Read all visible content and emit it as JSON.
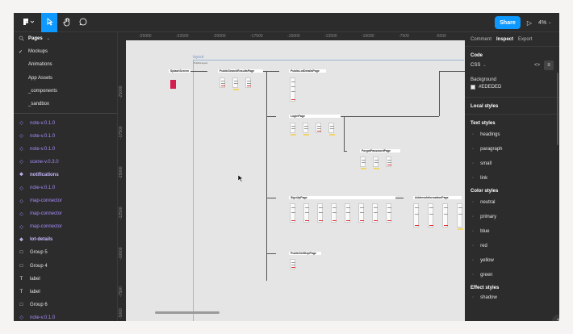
{
  "toolbar": {
    "logo_icon": "figma-menu-icon",
    "share_label": "Share",
    "play_icon": "play-icon",
    "zoom_label": "4%"
  },
  "pages": {
    "header": "Pages",
    "items": [
      {
        "label": "Mockups",
        "selected": true
      },
      {
        "label": "Animations"
      },
      {
        "label": "App Assets"
      },
      {
        "label": "_components"
      },
      {
        "label": "_sandbox"
      }
    ]
  },
  "layers": [
    {
      "label": "note-v.0.1.0",
      "icon": "component-icon",
      "color": "purple"
    },
    {
      "label": "note-v.0.1.0",
      "icon": "component-icon",
      "color": "purple"
    },
    {
      "label": "note-v.0.1.0",
      "icon": "component-icon",
      "color": "purple"
    },
    {
      "label": "scene-v.0.3.0",
      "icon": "component-icon",
      "color": "purple"
    },
    {
      "label": "notifications",
      "icon": "component-main-icon",
      "color": "purple-bold"
    },
    {
      "label": "note-v.0.1.0",
      "icon": "component-icon",
      "color": "purple"
    },
    {
      "label": "map-connector",
      "icon": "component-icon",
      "color": "purple"
    },
    {
      "label": "map-connector",
      "icon": "component-icon",
      "color": "purple"
    },
    {
      "label": "map-connector",
      "icon": "component-icon",
      "color": "purple"
    },
    {
      "label": "lot-details",
      "icon": "component-main-icon",
      "color": "purple-bold"
    },
    {
      "label": "Group 5",
      "icon": "frame-icon",
      "color": "white"
    },
    {
      "label": "Group 4",
      "icon": "frame-icon",
      "color": "white"
    },
    {
      "label": "label",
      "icon": "text-icon",
      "color": "white"
    },
    {
      "label": "label",
      "icon": "text-icon",
      "color": "white"
    },
    {
      "label": "Group 6",
      "icon": "frame-icon",
      "color": "white"
    },
    {
      "label": "note-v.0.1.0",
      "icon": "component-icon",
      "color": "purple"
    }
  ],
  "canvas": {
    "ruler_top": [
      "-25000",
      "-22500",
      "-20000",
      "-17500",
      "-15000",
      "-12500",
      "-10000",
      "-7500",
      "-5000"
    ],
    "ruler_left": [
      "-25000",
      "-17500",
      "-15000",
      "-12500",
      "-10000",
      "-7500",
      "-5000"
    ],
    "section_label": "layout",
    "section_sublabel": "PublicLayout",
    "frames": [
      {
        "title": "SplashScreen"
      },
      {
        "title": "PublicSearchResultsPage"
      },
      {
        "title": "PublicLotDetailsPage"
      },
      {
        "title": "LoginPage"
      },
      {
        "title": "ForgotPasswordPage"
      },
      {
        "title": "SignUpPage"
      },
      {
        "title": "AddressInformationPage"
      },
      {
        "title": "PublicSetStepPage"
      }
    ]
  },
  "inspect": {
    "tabs": [
      "Comment",
      "Inspect",
      "Export"
    ],
    "active_tab": "Inspect",
    "code_title": "Code",
    "code_lang": "CSS",
    "background_title": "Background",
    "background_value": "#EDEDED",
    "local_styles": "Local styles",
    "text_styles_title": "Text styles",
    "text_styles": [
      "headings",
      "paragraph",
      "small",
      "link"
    ],
    "color_styles_title": "Color styles",
    "color_styles": [
      "neutral",
      "primary",
      "blue",
      "red",
      "yellow",
      "green"
    ],
    "effect_styles_title": "Effect styles",
    "effect_styles": [
      "shadow"
    ],
    "help_label": "?"
  },
  "colors": {
    "accent": "#0d99ff",
    "panel": "#2c2c2c",
    "canvas": "#e5e5e5",
    "component_purple": "#a78bfa"
  }
}
